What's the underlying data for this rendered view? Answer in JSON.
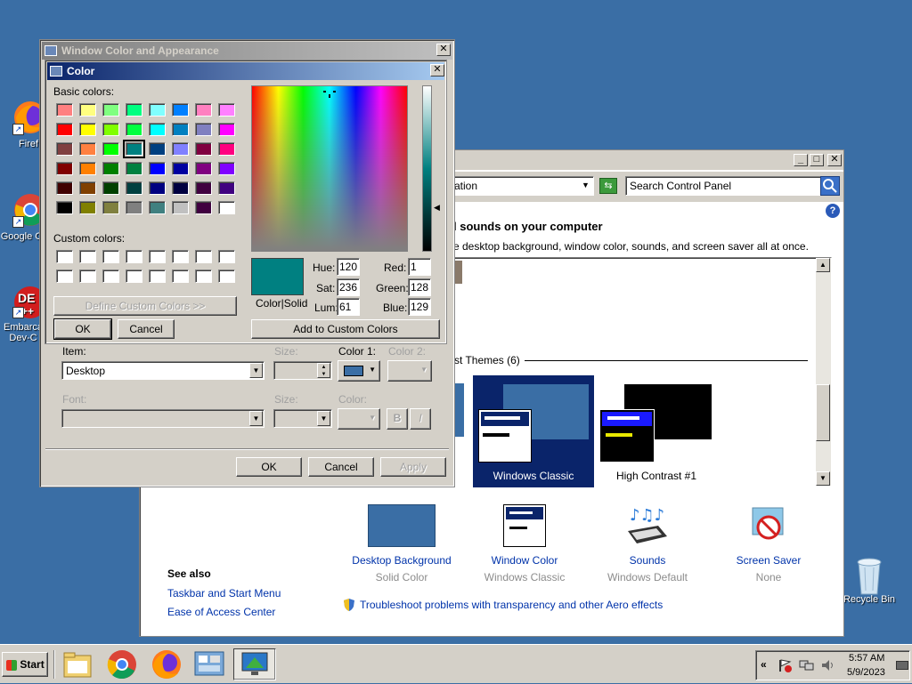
{
  "desktop": {
    "icons": [
      {
        "label": "Firef",
        "name": "firefox"
      },
      {
        "label": "Google C",
        "name": "chrome"
      },
      {
        "label": "Embarca Dev-C",
        "name": "devcpp"
      },
      {
        "label": "Recycle Bin",
        "name": "recycle-bin"
      }
    ],
    "background_color": "#3a6ea5"
  },
  "appearance_dialog": {
    "title": "Window Color and Appearance",
    "item_label": "Item:",
    "item_value": "Desktop",
    "size_label": "Size:",
    "color1_label": "Color 1:",
    "color1_swatch": "#3a6ea5",
    "color2_label": "Color 2:",
    "font_label": "Font:",
    "font_size_label": "Size:",
    "font_color_label": "Color:",
    "bold_label": "B",
    "italic_label": "I",
    "ok": "OK",
    "cancel": "Cancel",
    "apply": "Apply"
  },
  "color_dialog": {
    "title": "Color",
    "basic_colors_label": "Basic colors:",
    "custom_colors_label": "Custom colors:",
    "define_custom": "Define Custom Colors >>",
    "ok": "OK",
    "cancel": "Cancel",
    "color_solid_label": "Color|Solid",
    "preview_color": "#008081",
    "add_custom": "Add to Custom Colors",
    "hue_label": "Hue:",
    "hue": "120",
    "sat_label": "Sat:",
    "sat": "236",
    "lum_label": "Lum:",
    "lum": "61",
    "red_label": "Red:",
    "red": "1",
    "green_label": "Green:",
    "green": "128",
    "blue_label": "Blue:",
    "blue": "129",
    "basic_colors": [
      [
        "#ff8080",
        "#ffff80",
        "#80ff80",
        "#00ff80",
        "#80ffff",
        "#0080ff",
        "#ff80c0",
        "#ff80ff"
      ],
      [
        "#ff0000",
        "#ffff00",
        "#80ff00",
        "#00ff40",
        "#00ffff",
        "#0080c0",
        "#8080c0",
        "#ff00ff"
      ],
      [
        "#804040",
        "#ff8040",
        "#00ff00",
        "#008080",
        "#004080",
        "#8080ff",
        "#800040",
        "#ff0080"
      ],
      [
        "#800000",
        "#ff8000",
        "#008000",
        "#008040",
        "#0000ff",
        "#0000a0",
        "#800080",
        "#8000ff"
      ],
      [
        "#400000",
        "#804000",
        "#004000",
        "#004040",
        "#000080",
        "#000040",
        "#400040",
        "#400080"
      ],
      [
        "#000000",
        "#808000",
        "#808040",
        "#808080",
        "#408080",
        "#c0c0c0",
        "#400040",
        "#ffffff"
      ]
    ],
    "selected_basic": [
      2,
      3
    ]
  },
  "control_panel": {
    "address_fragment": "ation",
    "search_placeholder": "Search Control Panel",
    "heading": "l sounds on your computer",
    "subheading": "e desktop background, window color, sounds, and screen saver all at once.",
    "themes_group": "st Themes (6)",
    "themes": [
      {
        "label": "Windows Classic",
        "selected": true
      },
      {
        "label": "High Contrast #1",
        "selected": false
      }
    ],
    "see_also_title": "See also",
    "see_also_links": [
      "Taskbar and Start Menu",
      "Ease of Access Center"
    ],
    "bottom_items": [
      {
        "title": "Desktop Background",
        "sub": "Solid Color",
        "icon": "desktop-background-icon"
      },
      {
        "title": "Window Color",
        "sub": "Windows Classic",
        "icon": "window-color-icon"
      },
      {
        "title": "Sounds",
        "sub": "Windows Default",
        "icon": "sounds-icon"
      },
      {
        "title": "Screen Saver",
        "sub": "None",
        "icon": "screen-saver-icon"
      }
    ],
    "troubleshoot_link": "Troubleshoot problems with transparency and other Aero effects"
  },
  "taskbar": {
    "start_label": "Start",
    "clock_time": "5:57 AM",
    "clock_date": "5/9/2023",
    "tray_expand": "«"
  }
}
